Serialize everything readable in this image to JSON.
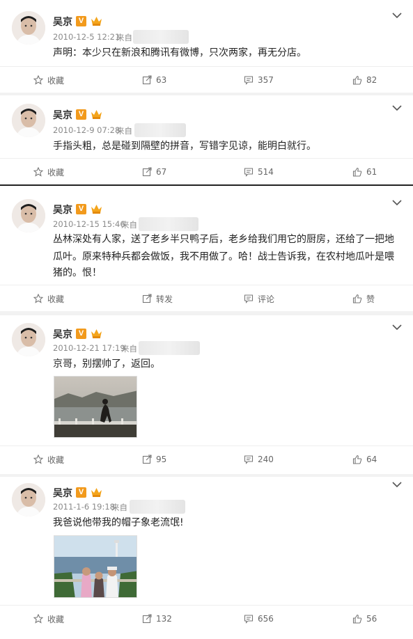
{
  "user": {
    "name": "吴京",
    "verified_badge": "V"
  },
  "posts": [
    {
      "date": "2010-12-5 12:21",
      "source_prefix": "来自",
      "text": "声明：本少只在新浪和腾讯有微博，只次两家，再无分店。",
      "favorite_label": "收藏",
      "repost": "63",
      "comment": "357",
      "like": "82"
    },
    {
      "date": "2010-12-9 07:28",
      "source_prefix": "来自",
      "text": "手指头粗，总是碰到隔壁的拼音，写错字见谅，能明白就行。",
      "favorite_label": "收藏",
      "repost": "67",
      "comment": "514",
      "like": "61"
    },
    {
      "date": "2010-12-15 15:46",
      "source_prefix": "来自",
      "text_line1": "丛林深处有人家，送了老乡半只鸭子后，老乡给我们用它的厨房，还给了一把地",
      "text_line2": "瓜叶。原来特种兵都会做饭，我不用做了。哈！战士告诉我，在农村地瓜叶是喂",
      "text_line3": "猪的。恨！",
      "favorite_label": "收藏",
      "repost": "转发",
      "comment": "评论",
      "like": "赞"
    },
    {
      "date": "2010-12-21 17:19",
      "source_prefix": "来自",
      "text": "京哥，别摆帅了，返回。",
      "favorite_label": "收藏",
      "repost": "95",
      "comment": "240",
      "like": "64"
    },
    {
      "date": "2011-1-6 19:18",
      "source_prefix": "来自",
      "text": "我爸说他带我的帽子象老流氓!",
      "favorite_label": "收藏",
      "repost": "132",
      "comment": "656",
      "like": "56"
    }
  ],
  "icons": {
    "favorite": "star-icon",
    "repost": "repost-icon",
    "comment": "comment-icon",
    "like": "thumbs-up-icon",
    "menu": "chevron-down-icon"
  },
  "colors": {
    "verified": "#f29a1c",
    "meta_text": "#8a8a8a"
  }
}
